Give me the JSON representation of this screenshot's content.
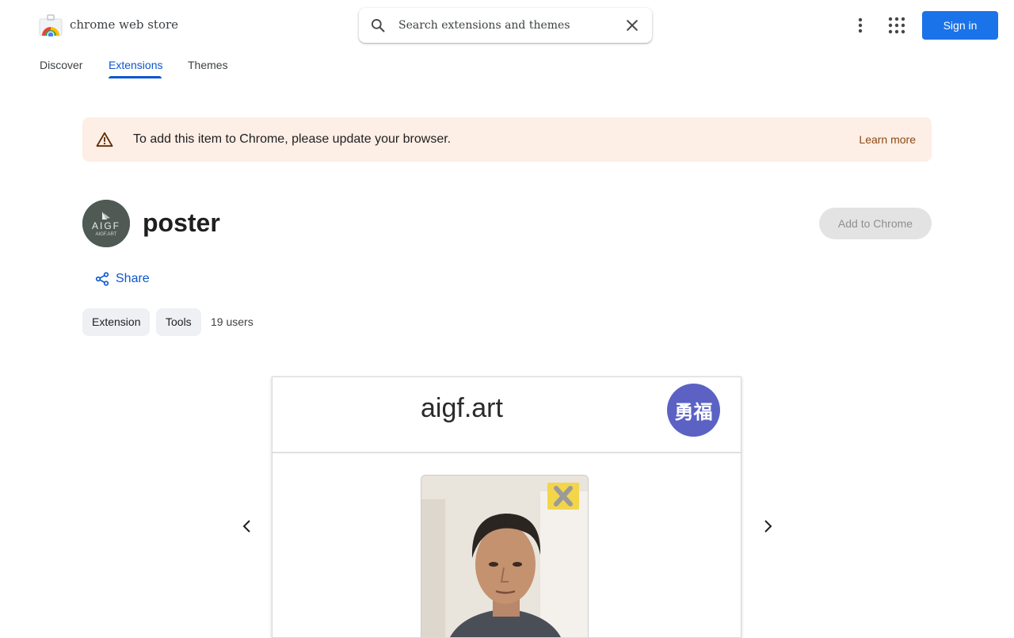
{
  "header": {
    "store_name": "chrome web store",
    "search_placeholder": "Search extensions and themes",
    "sign_in_label": "Sign in"
  },
  "nav": {
    "tabs": [
      {
        "label": "Discover"
      },
      {
        "label": "Extensions"
      },
      {
        "label": "Themes"
      }
    ],
    "active": "Extensions"
  },
  "banner": {
    "message": "To add this item to Chrome, please update your browser.",
    "link_label": "Learn more"
  },
  "item": {
    "icon_text": "AIGF",
    "icon_subtext": "AIGF.ART",
    "title": "poster",
    "add_button_label": "Add to Chrome",
    "share_label": "Share",
    "chips": [
      "Extension",
      "Tools"
    ],
    "users": "19 users"
  },
  "screenshot": {
    "site_name": "aigf.art",
    "avatar_text": "勇福"
  },
  "colors": {
    "accent": "#1a73e8",
    "active_tab": "#0b57d0",
    "banner_bg": "#fdeee6",
    "link_brown": "#8a4a14",
    "disabled_button": "#e3e3e3",
    "avatar_purple": "#5b62c4"
  }
}
